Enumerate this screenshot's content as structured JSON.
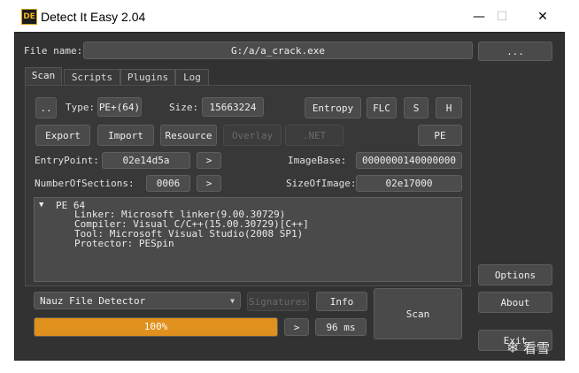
{
  "window": {
    "title": "Detect It Easy 2.04",
    "icon_letters": "DE",
    "minimize_glyph": "—",
    "maximize_glyph": "☐",
    "close_glyph": "✕"
  },
  "file": {
    "label": "File name:",
    "value": "G:/a/a_crack.exe",
    "browse_label": "..."
  },
  "tabs": [
    {
      "label": "Scan",
      "active": true
    },
    {
      "label": "Scripts",
      "active": false
    },
    {
      "label": "Plugins",
      "active": false
    },
    {
      "label": "Log",
      "active": false
    }
  ],
  "scan": {
    "dotdot_label": "..",
    "type_label": "Type:",
    "type_value": "PE+(64)",
    "size_label": "Size:",
    "size_value": "15663224",
    "entropy_label": "Entropy",
    "flc_label": "FLC",
    "s_label": "S",
    "h_label": "H",
    "export_label": "Export",
    "import_label": "Import",
    "resource_label": "Resource",
    "overlay_label": "Overlay",
    "net_label": ".NET",
    "pe_label": "PE",
    "entrypoint_label": "EntryPoint:",
    "entrypoint_value": "02e14d5a",
    "imagebase_label": "ImageBase:",
    "imagebase_value": "0000000140000000",
    "sections_label": "NumberOfSections:",
    "sections_value": "0006",
    "sizeofimage_label": "SizeOfImage:",
    "sizeofimage_value": "02e17000",
    "more_glyph": ">"
  },
  "results": {
    "root": "PE 64",
    "lines": [
      "Linker: Microsoft linker(9.00.30729)",
      "Compiler: Visual C/C++(15.00.30729)[C++]",
      "Tool: Microsoft Visual Studio(2008 SP1)",
      "Protector: PESpin"
    ]
  },
  "detector": {
    "selected": "Nauz File Detector",
    "signatures_label": "Signatures",
    "info_label": "Info",
    "scan_label": "Scan",
    "progress_percent": 100,
    "progress_text": "100%",
    "time_value": "96 ms"
  },
  "side": {
    "options_label": "Options",
    "about_label": "About",
    "exit_label": "Exit"
  },
  "watermark": {
    "text": "看雪"
  },
  "colors": {
    "accent": "#e0901c",
    "background": "#323232"
  }
}
